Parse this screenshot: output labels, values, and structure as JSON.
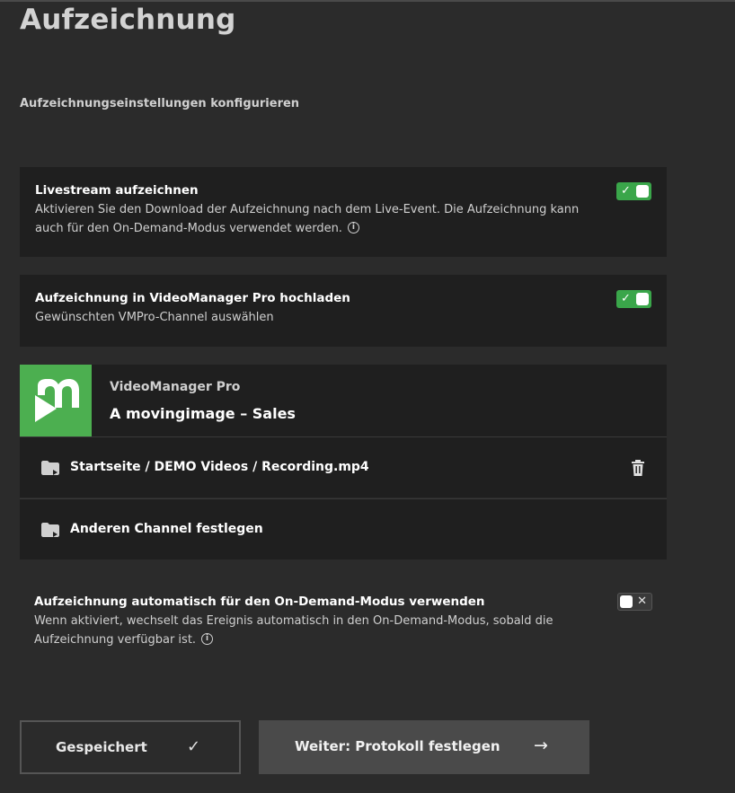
{
  "page": {
    "title": "Aufzeichnung",
    "subtitle": "Aufzeichnungseinstellungen konfigurieren"
  },
  "record_stream": {
    "title": "Livestream aufzeichnen",
    "description": "Aktivieren Sie den Download der Aufzeichnung nach dem Live-Event. Die Aufzeichnung kann auch für den On-Demand-Modus verwendet werden.",
    "enabled": true,
    "toggle_mark": "✓"
  },
  "upload_vmpro": {
    "title": "Aufzeichnung in VideoManager Pro hochladen",
    "description": "Gewünschten VMPro-Channel auswählen",
    "enabled": true,
    "toggle_mark": "✓"
  },
  "videomanager": {
    "logo_color": "#4caf50",
    "product_name": "VideoManager Pro",
    "account_name": "A movingimage – Sales",
    "selected_path": "Startseite / DEMO Videos / Recording.mp4",
    "other_channel_label": "Anderen Channel festlegen"
  },
  "auto_ondemand": {
    "title": "Aufzeichnung automatisch für den On-Demand-Modus verwenden",
    "description": "Wenn aktiviert, wechselt das Ereignis automatisch in den On-Demand-Modus, sobald die Aufzeichnung verfügbar ist.",
    "enabled": false,
    "toggle_mark": "✕"
  },
  "info_glyph": "i",
  "buttons": {
    "saved_label": "Gespeichert",
    "saved_icon": "✓",
    "next_label": "Weiter: Protokoll festlegen",
    "next_icon": "→"
  },
  "colors": {
    "accent_green": "#3aa64a",
    "background": "#2b2b2b",
    "panel": "#1f1f1f"
  }
}
